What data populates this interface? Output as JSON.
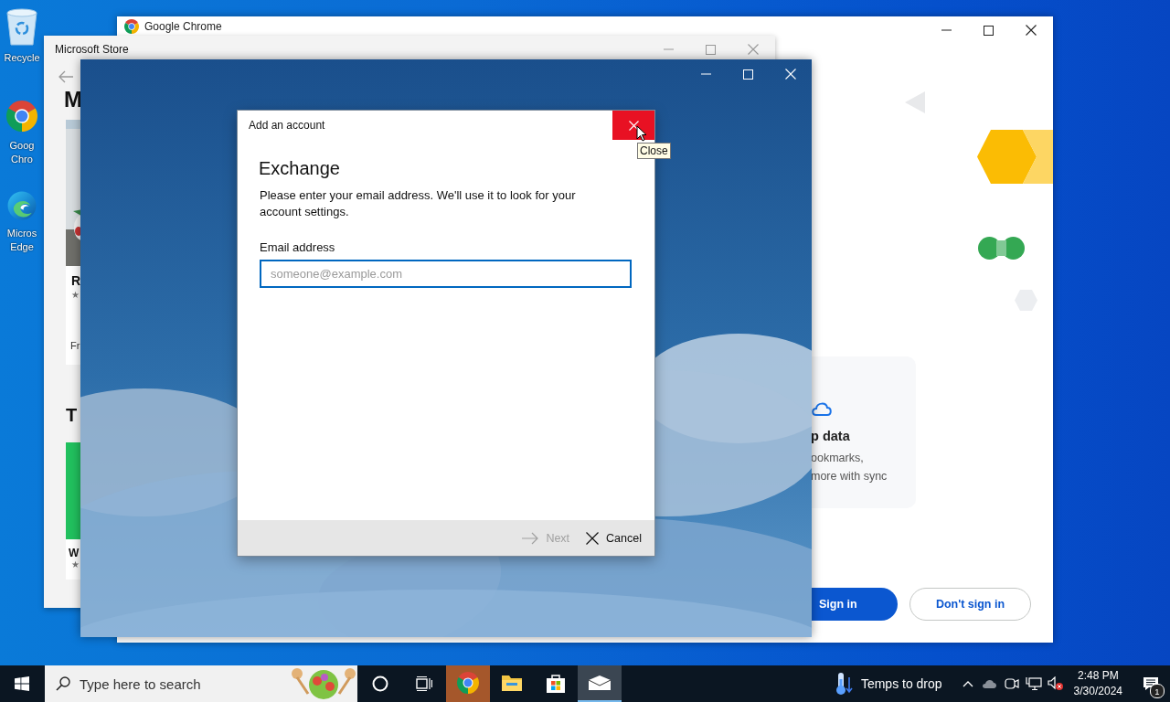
{
  "desktop_icons": [
    {
      "kind": "recycle",
      "lines": [
        "Recycle"
      ]
    },
    {
      "kind": "chrome",
      "lines": [
        "Goog",
        "Chro"
      ]
    },
    {
      "kind": "edge",
      "lines": [
        "Micros",
        "Edge"
      ]
    }
  ],
  "chrome_window": {
    "title": "Google Chrome",
    "card_title": "p data",
    "card_lines": [
      "ookmarks,",
      "more with sync"
    ],
    "buttons": [
      {
        "label": "Sign in",
        "kind": "primary"
      },
      {
        "label": "Don't sign in",
        "kind": "secondary"
      }
    ]
  },
  "store_window": {
    "title": "Microsoft Store",
    "heading": "M",
    "card_title": "R",
    "card_rating": "★",
    "card_price": "Fr",
    "section": "T",
    "tile_title": "W",
    "tile_rating": "★"
  },
  "dialog": {
    "title": "Add an account",
    "close_tooltip": "Close",
    "heading": "Exchange",
    "description": "Please enter your email address. We'll use it to look for your account settings.",
    "field_label": "Email address",
    "placeholder": "someone@example.com",
    "actions": [
      {
        "kind": "next",
        "label": "Next",
        "disabled": true
      },
      {
        "kind": "cancel",
        "label": "Cancel",
        "disabled": false
      }
    ]
  },
  "taskbar": {
    "search_placeholder": "Type here to search",
    "apps": [
      {
        "kind": "chrome",
        "selected": false,
        "flashing": true
      },
      {
        "kind": "explorer",
        "selected": false,
        "flashing": false
      },
      {
        "kind": "store",
        "selected": false,
        "flashing": false
      },
      {
        "kind": "mail",
        "selected": true,
        "flashing": false
      }
    ],
    "weather": "Temps to drop",
    "time": "2:48 PM",
    "date": "3/30/2024",
    "notifications": "1"
  }
}
